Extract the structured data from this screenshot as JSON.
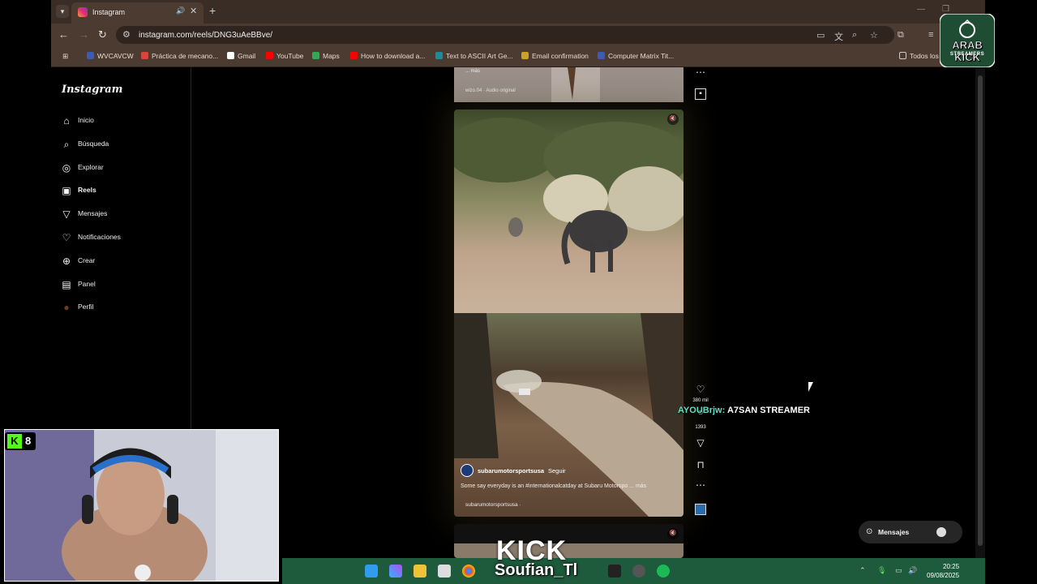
{
  "browser": {
    "tab_title": "Instagram",
    "url": "instagram.com/reels/DNG3uAeBBve/",
    "bookmarks": [
      "WVCAVCW",
      "Práctica de mecano...",
      "Gmail",
      "YouTube",
      "Maps",
      "How to download a...",
      "Text to ASCII Art Ge...",
      "Email confirmation",
      "Computer Matrix Tit...",
      "Todos los"
    ]
  },
  "instagram": {
    "logo": "Instagram",
    "nav": [
      {
        "label": "Inicio",
        "icon": "home-icon"
      },
      {
        "label": "Búsqueda",
        "icon": "search-icon"
      },
      {
        "label": "Explorar",
        "icon": "compass-icon"
      },
      {
        "label": "Reels",
        "icon": "reels-icon"
      },
      {
        "label": "Mensajes",
        "icon": "send-icon"
      },
      {
        "label": "Notificaciones",
        "icon": "heart-icon"
      },
      {
        "label": "Crear",
        "icon": "plus-icon"
      },
      {
        "label": "Panel",
        "icon": "chart-icon"
      },
      {
        "label": "Perfil",
        "icon": "avatar-icon"
      }
    ],
    "reel_prev": {
      "more": "... más",
      "audio": "wizo.04 · Audio original"
    },
    "reel": {
      "username": "subarumotorsportsusa",
      "follow": "Seguir",
      "caption": "Some say everyday is an #internationalcatday at Subaru Motorspo ... más",
      "audio": "subarumotorsportsusa ·",
      "likes": "380 mil",
      "comments": "1393"
    },
    "messages_pill": "Mensajes"
  },
  "stream": {
    "chat_user": "AYOUBrjw:",
    "chat_message": "A7SAN STREAMER",
    "viewer_count": "8",
    "kick_badge": "K",
    "watermark": "KICK",
    "streamer_name": "Soufian_Tl",
    "overlay_logo_line1": "ARAB KICK",
    "overlay_logo_line2": "STREAMERS"
  },
  "taskbar": {
    "time": "20:25",
    "date": "09/08/2025"
  }
}
